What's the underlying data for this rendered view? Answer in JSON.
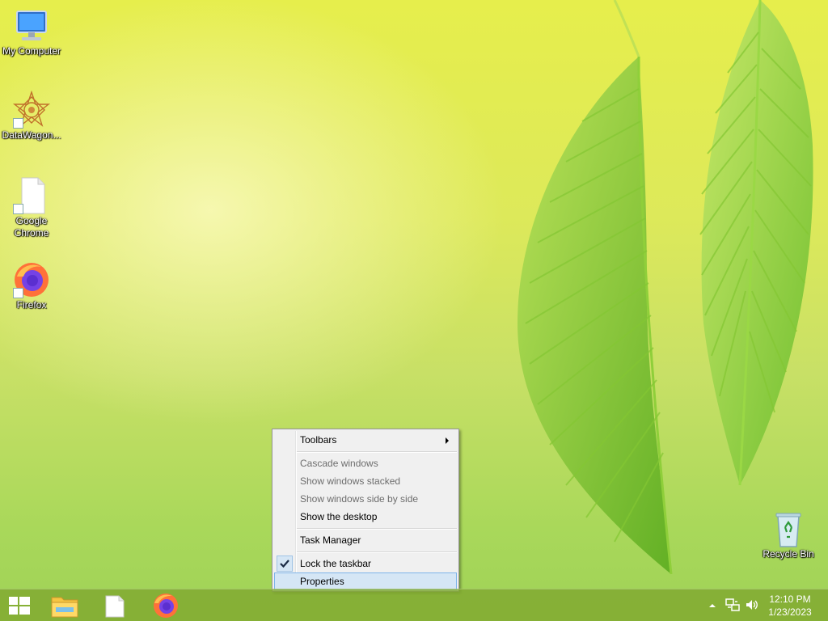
{
  "desktop": {
    "icons": [
      {
        "label": "My Computer",
        "icon": "computer-icon"
      },
      {
        "label": "DataWagon...",
        "icon": "datawagon-icon"
      },
      {
        "label": "Google Chrome",
        "icon": "file-icon"
      },
      {
        "label": "Firefox",
        "icon": "firefox-icon"
      },
      {
        "label": "Recycle Bin",
        "icon": "recycle-bin-icon"
      }
    ]
  },
  "context_menu": {
    "items": [
      {
        "label": "Toolbars",
        "state": "enabled",
        "has_submenu": true
      },
      {
        "label": "Cascade windows",
        "state": "disabled"
      },
      {
        "label": "Show windows stacked",
        "state": "disabled"
      },
      {
        "label": "Show windows side by side",
        "state": "disabled"
      },
      {
        "label": "Show the desktop",
        "state": "enabled"
      },
      {
        "label": "Task Manager",
        "state": "enabled"
      },
      {
        "label": "Lock the taskbar",
        "state": "enabled",
        "checked": true
      },
      {
        "label": "Properties",
        "state": "highlighted"
      }
    ]
  },
  "taskbar": {
    "buttons": [
      {
        "icon": "windows-start-icon"
      },
      {
        "icon": "file-explorer-icon"
      },
      {
        "icon": "file-icon"
      },
      {
        "icon": "firefox-icon"
      }
    ],
    "tray": {
      "icons": [
        "chevron-up-icon",
        "network-icon",
        "speaker-icon"
      ],
      "time": "12:10 PM",
      "date": "1/23/2023"
    }
  },
  "colors": {
    "menu_highlight": "#d5e6f5",
    "menu_highlight_border": "#7eb4ea",
    "taskbar": "#80a830"
  }
}
